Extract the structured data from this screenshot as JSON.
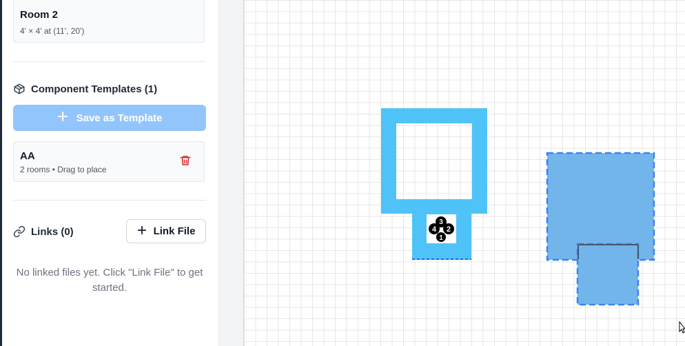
{
  "rooms": [
    {
      "name": "Room 2",
      "details": "4' × 4' at (11', 20')"
    }
  ],
  "component_templates": {
    "heading": "Component Templates (1)",
    "icon": "package-icon",
    "save_button_label": "Save as Template",
    "templates": [
      {
        "name": "AA",
        "details": "2 rooms • Drag to place",
        "delete_icon": "trash-icon"
      }
    ]
  },
  "links": {
    "heading": "Links (0)",
    "icon": "link-icon",
    "link_button_label": "Link File",
    "empty_message": "No linked files yet. Click \"Link File\" to get started."
  },
  "canvas": {
    "compass_labels": [
      "3",
      "4",
      "2",
      "1"
    ],
    "colors": {
      "room_fill": "#4fc3f7",
      "selected_fill": "#71b5ea",
      "selected_border": "#3b82f6",
      "grid": "#e7e7e9"
    }
  }
}
